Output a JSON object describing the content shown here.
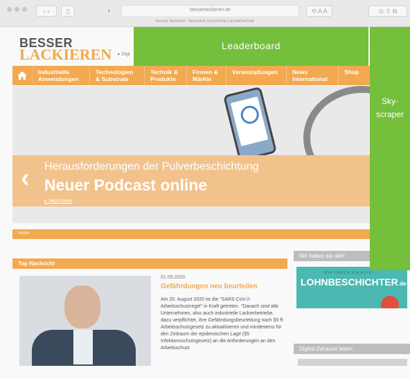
{
  "browser": {
    "url": "besserlackieren.de",
    "page_subtitle": "besser lackieren: Netzwerk industrielle Lackiertechnik"
  },
  "site": {
    "brand_line1": "BESSER",
    "brand_line2": "LACKIEREN",
    "tagline_fragment": "▸ Digi",
    "nav": [
      {
        "label": "Industrielle Anwendungen"
      },
      {
        "label": "Technologien & Substrate"
      },
      {
        "label": "Technik & Produkte"
      },
      {
        "label": "Firmen & Märkte"
      },
      {
        "label": "Veranstaltungen"
      },
      {
        "label": "News International"
      },
      {
        "label": "Shop"
      }
    ],
    "hero": {
      "kicker": "Herausforderungen der Pulverbeschichtung",
      "title": "Neuer Podcast online",
      "link": "▸ Jetzt hören"
    },
    "breadcrumb": "Home",
    "top_news_heading": "Top Nachricht",
    "article": {
      "date": "01.09.2020",
      "title": "Gefährdungen neu beurteilen",
      "body": "Am 20. August 2020 ist die \"SARS CoV-2-Arbeitsschutzregel\" in Kraft getreten. \"Danach sind alle Unternehmen, also auch industrielle Lackierbetriebe, dazu verpflichtet, ihre Gefährdungsbeurteilung nach §5 ff. Arbeitsschutzgesetz zu aktualisieren und mindestens für den Zeitraum der epidemischen Lage (§5 Infektionsschutzgesetz) an die Anforderungen an den Arbeitsschutz"
    },
    "sidebar": {
      "heading": "Wir haben sie alle!",
      "ad_small": "WIR HABEN SIE ALLE!",
      "ad_big": "LOHNBESCHICHTER",
      "ad_suffix": ".de",
      "heading2": "Digital Zuhause lesen"
    }
  },
  "ad_slots": {
    "leaderboard": "Leaderboard",
    "skyscraper": "Sky-\nscraper"
  }
}
